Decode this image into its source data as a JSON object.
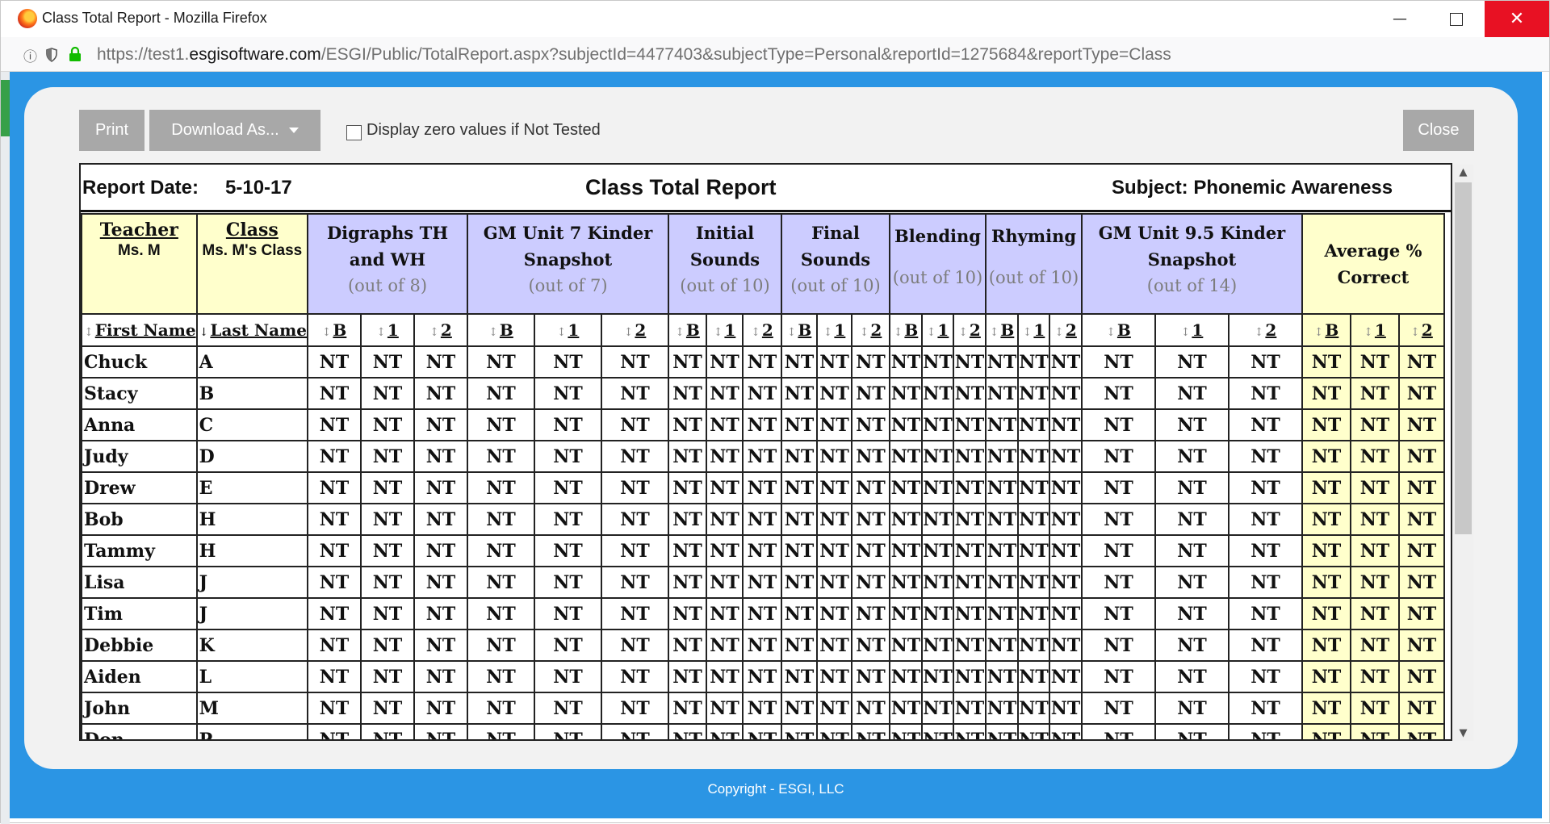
{
  "window": {
    "title": "Class Total Report - Mozilla Firefox",
    "minimize_glyph": "—",
    "close_glyph": "✕"
  },
  "address_bar": {
    "url_prefix": "https://test1.",
    "url_host": "esgisoftware.com",
    "url_path": "/ESGI/Public/TotalReport.aspx?subjectId=4477403&subjectType=Personal&reportId=1275684&reportType=Class",
    "icons": [
      "info-icon",
      "shield-icon",
      "lock-icon"
    ]
  },
  "toolbar": {
    "print_label": "Print",
    "download_label": "Download As...",
    "zero_values_label": "Display zero values if Not Tested",
    "close_label": "Close"
  },
  "report": {
    "date_label": "Report Date:",
    "date_value": "5-10-17",
    "title": "Class Total Report",
    "subject": "Subject: Phonemic Awareness",
    "teacher_title": "Teacher",
    "teacher_name": "Ms. M",
    "class_title": "Class",
    "class_name": "Ms. M's Class",
    "first_name_header": "First Name",
    "last_name_header": "Last Name",
    "tests": [
      {
        "name": "Digraphs TH and WH",
        "out_of": "(out of 8)"
      },
      {
        "name": "GM Unit 7 Kinder Snapshot",
        "out_of": "(out of 7)"
      },
      {
        "name": "Initial Sounds",
        "out_of": "(out of 10)"
      },
      {
        "name": "Final Sounds",
        "out_of": "(out of 10)"
      },
      {
        "name": "Blending",
        "out_of": "(out of 10)"
      },
      {
        "name": "Rhyming",
        "out_of": "(out of 10)"
      },
      {
        "name": "GM Unit 9.5 Kinder Snapshot",
        "out_of": "(out of 14)"
      }
    ],
    "average_header": "Average % Correct",
    "sub_columns": [
      "B",
      "1",
      "2"
    ],
    "students": [
      {
        "first": "Chuck",
        "last": "A"
      },
      {
        "first": "Stacy",
        "last": "B"
      },
      {
        "first": "Anna",
        "last": "C"
      },
      {
        "first": "Judy",
        "last": "D"
      },
      {
        "first": "Drew",
        "last": "E"
      },
      {
        "first": "Bob",
        "last": "H"
      },
      {
        "first": "Tammy",
        "last": "H"
      },
      {
        "first": "Lisa",
        "last": "J"
      },
      {
        "first": "Tim",
        "last": "J"
      },
      {
        "first": "Debbie",
        "last": "K"
      },
      {
        "first": "Aiden",
        "last": "L"
      },
      {
        "first": "John",
        "last": "M"
      },
      {
        "first": "Don",
        "last": "P"
      }
    ],
    "cell_value": "NT"
  },
  "footer": {
    "copyright": "Copyright - ESGI, LLC"
  },
  "colors": {
    "modal_frame": "#2b95e4",
    "test_header_bg": "#ccccff",
    "average_bg": "#ffffcc",
    "button_bg": "#a8a8a8",
    "close_window_bg": "#e81123"
  }
}
